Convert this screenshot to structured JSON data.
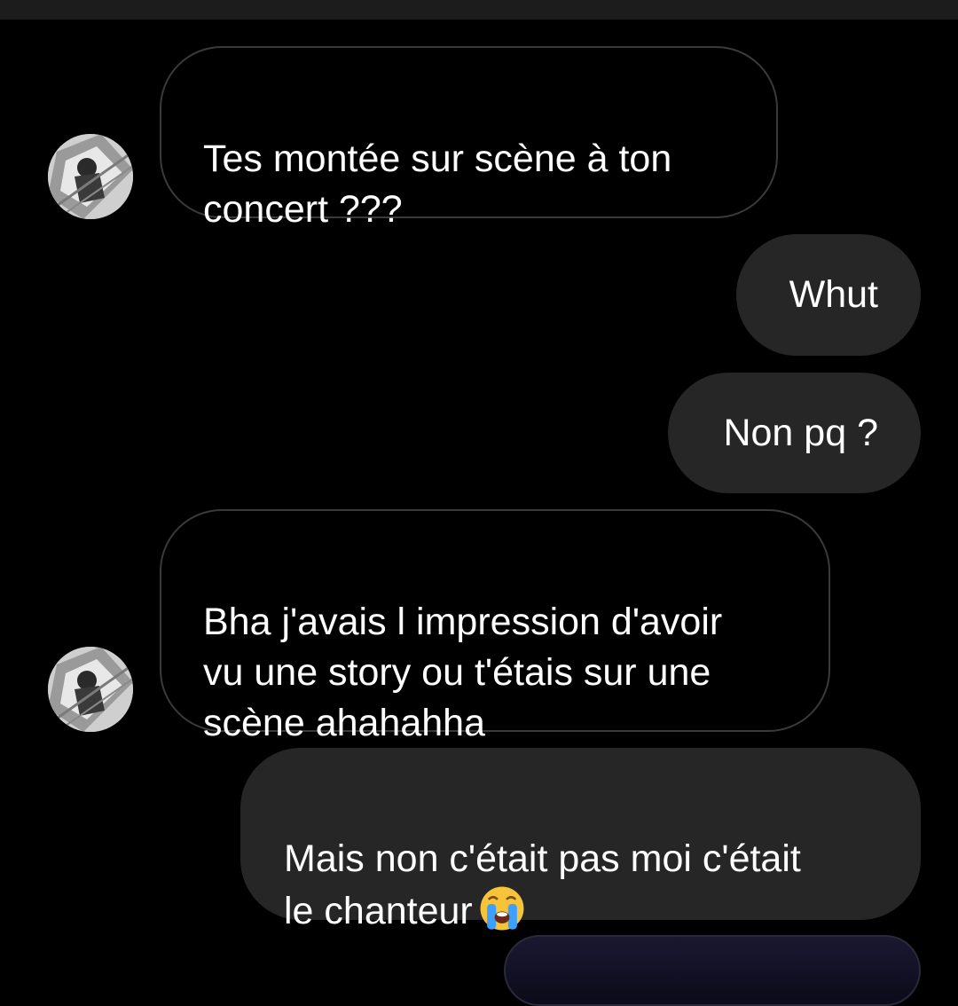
{
  "messages": [
    {
      "direction": "incoming",
      "text": "Tes montée sur scène à ton\nconcert ???"
    },
    {
      "direction": "outgoing",
      "text": "Whut"
    },
    {
      "direction": "outgoing",
      "text": "Non pq ?"
    },
    {
      "direction": "incoming",
      "text": "Bha j'avais l impression d'avoir\nvu une story ou t'étais sur une\nscène ahahahha"
    },
    {
      "direction": "outgoing",
      "text": "Mais non c'était pas moi c'était\nle chanteur",
      "emoji": "loudly-crying-face"
    }
  ],
  "colors": {
    "background": "#000000",
    "outgoing_bubble": "#262626",
    "incoming_border": "#3a3a3a",
    "text": "#ffffff"
  }
}
